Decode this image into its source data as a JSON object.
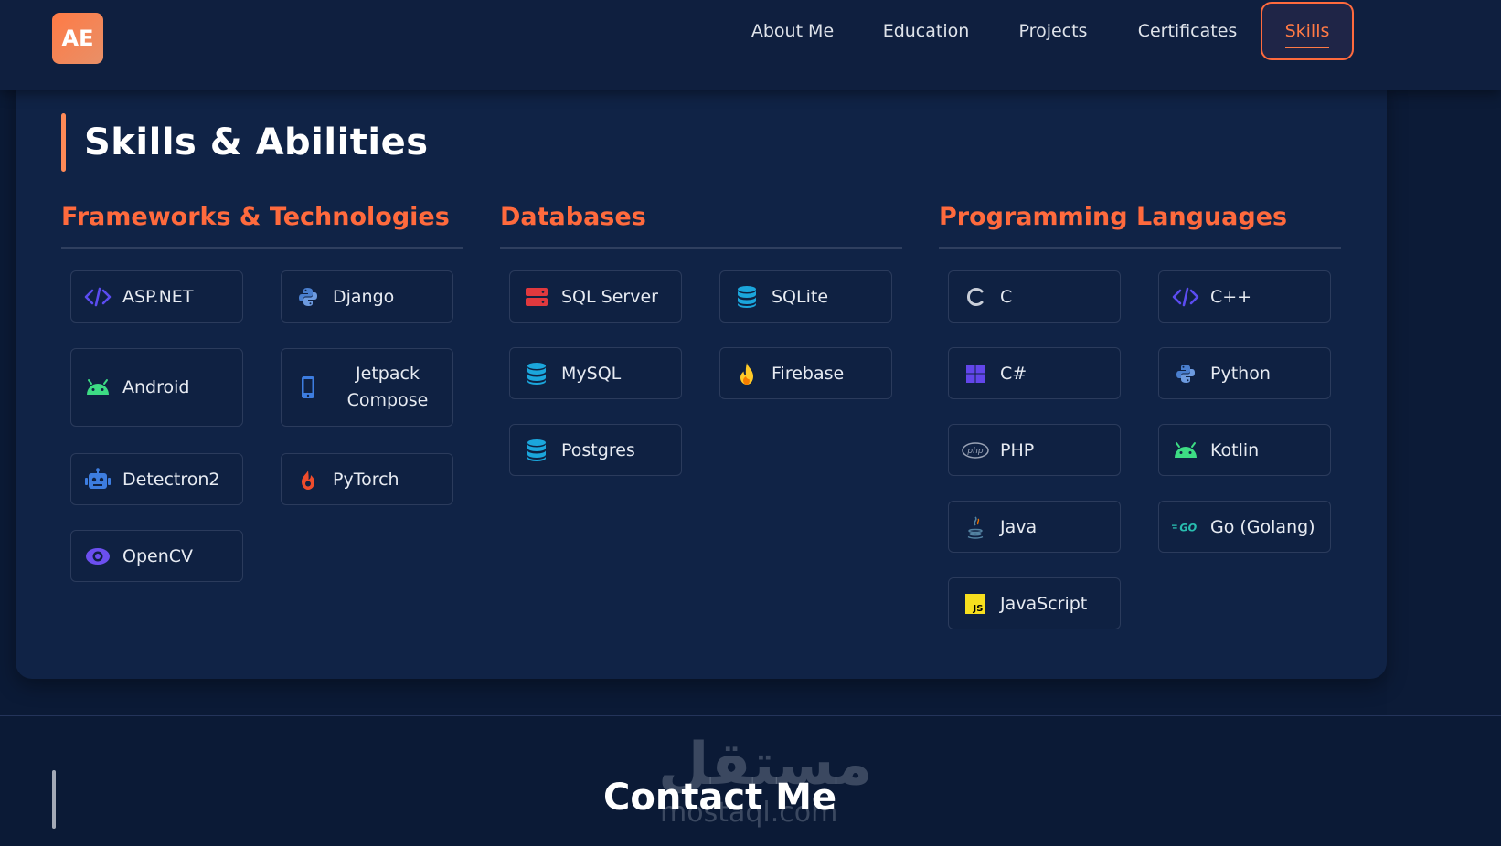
{
  "logo": {
    "text": "AE"
  },
  "nav": [
    {
      "label": "About Me",
      "active": false
    },
    {
      "label": "Education",
      "active": false
    },
    {
      "label": "Projects",
      "active": false
    },
    {
      "label": "Certificates",
      "active": false
    },
    {
      "label": "Skills",
      "active": true
    }
  ],
  "page_title": "Skills & Abilities",
  "categories": [
    {
      "title": "Frameworks & Technologies",
      "items": [
        {
          "label": "ASP.NET",
          "icon": "code-icon"
        },
        {
          "label": "Django",
          "icon": "python-icon"
        },
        {
          "label": "Android",
          "icon": "android-icon"
        },
        {
          "label": "Jetpack Compose",
          "icon": "mobile-icon"
        },
        {
          "label": "Detectron2",
          "icon": "robot-icon"
        },
        {
          "label": "PyTorch",
          "icon": "fire-icon"
        },
        {
          "label": "OpenCV",
          "icon": "eye-icon"
        }
      ]
    },
    {
      "title": "Databases",
      "items": [
        {
          "label": "SQL Server",
          "icon": "server-icon"
        },
        {
          "label": "SQLite",
          "icon": "database-icon"
        },
        {
          "label": "MySQL",
          "icon": "database-icon"
        },
        {
          "label": "Firebase",
          "icon": "flame-icon"
        },
        {
          "label": "Postgres",
          "icon": "database-icon"
        }
      ]
    },
    {
      "title": "Programming Languages",
      "items": [
        {
          "label": "C",
          "icon": "c-letter-icon"
        },
        {
          "label": "C++",
          "icon": "code-icon"
        },
        {
          "label": "C#",
          "icon": "windows-icon"
        },
        {
          "label": "Python",
          "icon": "python-icon"
        },
        {
          "label": "PHP",
          "icon": "php-icon"
        },
        {
          "label": "Kotlin",
          "icon": "android-icon"
        },
        {
          "label": "Java",
          "icon": "java-icon"
        },
        {
          "label": "Go (Golang)",
          "icon": "go-icon"
        },
        {
          "label": "JavaScript",
          "icon": "javascript-icon"
        }
      ]
    }
  ],
  "footer": {
    "contact_title": "Contact Me",
    "watermark": "مستقل",
    "watermark_sub": "mostaql.com"
  },
  "colors": {
    "accent": "#ff6a3d",
    "background": "#0b1a36",
    "card": "#102346"
  }
}
